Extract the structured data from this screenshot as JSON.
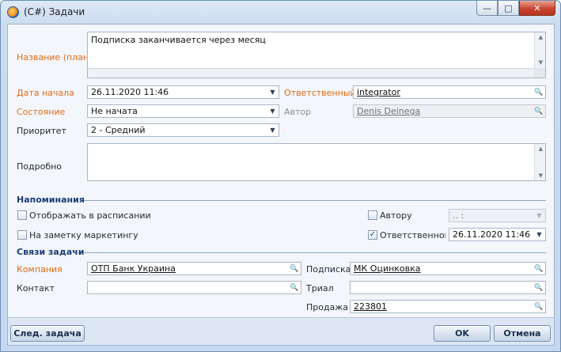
{
  "window": {
    "title": "(C#) Задачи"
  },
  "titlebar": {
    "minimize": "—",
    "maximize": "□",
    "close": "✕"
  },
  "task": {
    "name_label": "Название (план)",
    "name_value": "Подписка заканчивается через месяц",
    "start_label": "Дата начала",
    "start_value": "26.11.2020 11:46",
    "state_label": "Состояние",
    "state_value": "Не начата",
    "priority_label": "Приоритет",
    "priority_value": "2 - Средний",
    "responsible_label": "Ответственный",
    "responsible_value": "integrator",
    "author_label": "Автор",
    "author_value": "Denis Deinega",
    "details_label": "Подробно",
    "details_value": ""
  },
  "reminders": {
    "section_title": "Напоминания",
    "show_schedule_label": "Отображать в расписании",
    "marketing_label": "На заметку маркетингу",
    "author_label": "Автору",
    "author_time": ".. :",
    "responsible_label": "Ответственному",
    "responsible_time": "26.11.2020 11:46",
    "show_schedule_checked": false,
    "marketing_checked": false,
    "author_checked": false,
    "responsible_checked": true
  },
  "links": {
    "section_title": "Связи задачи",
    "company_label": "Компания",
    "company_value": "ОТП Банк Украина",
    "contact_label": "Контакт",
    "contact_value": "",
    "subscription_label": "Подписка",
    "subscription_value": "МК Оцинковка",
    "trial_label": "Триал",
    "trial_value": "",
    "sale_label": "Продажа",
    "sale_value": "223801"
  },
  "footer": {
    "next_task": "След. задача",
    "ok": "OK",
    "cancel": "Отмена"
  },
  "icons": {
    "dropdown": "▼",
    "lookup": "🔍",
    "check": "✓"
  },
  "colors": {
    "required_label": "#e06b17",
    "section_title": "#1c3e74",
    "window_frame": "#6f8fb5"
  }
}
